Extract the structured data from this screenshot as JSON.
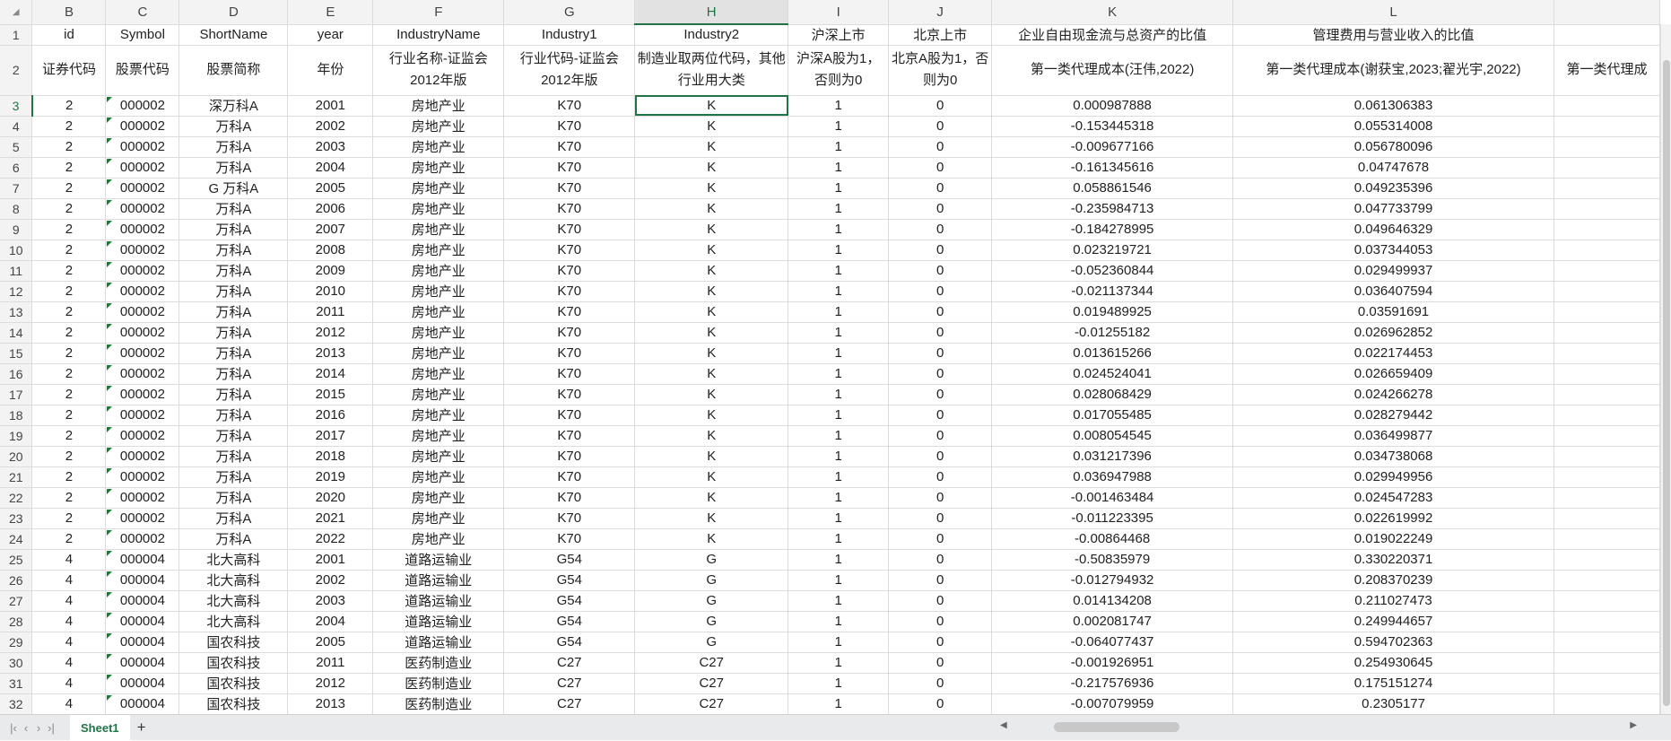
{
  "columns": [
    "B",
    "C",
    "D",
    "E",
    "F",
    "G",
    "H",
    "I",
    "J",
    "K",
    "L",
    ""
  ],
  "row1": [
    "id",
    "Symbol",
    "ShortName",
    "year",
    "IndustryName",
    "Industry1",
    "Industry2",
    "沪深上市",
    "北京上市",
    "企业自由现金流与总资产的比值",
    "管理费用与营业收入的比值",
    ""
  ],
  "row2": [
    "证券代码",
    "股票代码",
    "股票简称",
    "年份",
    "行业名称-证监会2012年版",
    "行业代码-证监会2012年版",
    "制造业取两位代码，其他行业用大类",
    "沪深A股为1，否则为0",
    "北京A股为1，否则为0",
    "第一类代理成本(汪伟,2022)",
    "第一类代理成本(谢获宝,2023;翟光宇,2022)",
    "第一类代理成"
  ],
  "rows": [
    [
      "2",
      "000002",
      "深万科A",
      "2001",
      "房地产业",
      "K70",
      "K",
      "1",
      "0",
      "0.000987888",
      "0.061306383"
    ],
    [
      "2",
      "000002",
      "万科A",
      "2002",
      "房地产业",
      "K70",
      "K",
      "1",
      "0",
      "-0.153445318",
      "0.055314008"
    ],
    [
      "2",
      "000002",
      "万科A",
      "2003",
      "房地产业",
      "K70",
      "K",
      "1",
      "0",
      "-0.009677166",
      "0.056780096"
    ],
    [
      "2",
      "000002",
      "万科A",
      "2004",
      "房地产业",
      "K70",
      "K",
      "1",
      "0",
      "-0.161345616",
      "0.04747678"
    ],
    [
      "2",
      "000002",
      "G 万科A",
      "2005",
      "房地产业",
      "K70",
      "K",
      "1",
      "0",
      "0.058861546",
      "0.049235396"
    ],
    [
      "2",
      "000002",
      "万科A",
      "2006",
      "房地产业",
      "K70",
      "K",
      "1",
      "0",
      "-0.235984713",
      "0.047733799"
    ],
    [
      "2",
      "000002",
      "万科A",
      "2007",
      "房地产业",
      "K70",
      "K",
      "1",
      "0",
      "-0.184278995",
      "0.049646329"
    ],
    [
      "2",
      "000002",
      "万科A",
      "2008",
      "房地产业",
      "K70",
      "K",
      "1",
      "0",
      "0.023219721",
      "0.037344053"
    ],
    [
      "2",
      "000002",
      "万科A",
      "2009",
      "房地产业",
      "K70",
      "K",
      "1",
      "0",
      "-0.052360844",
      "0.029499937"
    ],
    [
      "2",
      "000002",
      "万科A",
      "2010",
      "房地产业",
      "K70",
      "K",
      "1",
      "0",
      "-0.021137344",
      "0.036407594"
    ],
    [
      "2",
      "000002",
      "万科A",
      "2011",
      "房地产业",
      "K70",
      "K",
      "1",
      "0",
      "0.019489925",
      "0.03591691"
    ],
    [
      "2",
      "000002",
      "万科A",
      "2012",
      "房地产业",
      "K70",
      "K",
      "1",
      "0",
      "-0.01255182",
      "0.026962852"
    ],
    [
      "2",
      "000002",
      "万科A",
      "2013",
      "房地产业",
      "K70",
      "K",
      "1",
      "0",
      "0.013615266",
      "0.022174453"
    ],
    [
      "2",
      "000002",
      "万科A",
      "2014",
      "房地产业",
      "K70",
      "K",
      "1",
      "0",
      "0.024524041",
      "0.026659409"
    ],
    [
      "2",
      "000002",
      "万科A",
      "2015",
      "房地产业",
      "K70",
      "K",
      "1",
      "0",
      "0.028068429",
      "0.024266278"
    ],
    [
      "2",
      "000002",
      "万科A",
      "2016",
      "房地产业",
      "K70",
      "K",
      "1",
      "0",
      "0.017055485",
      "0.028279442"
    ],
    [
      "2",
      "000002",
      "万科A",
      "2017",
      "房地产业",
      "K70",
      "K",
      "1",
      "0",
      "0.008054545",
      "0.036499877"
    ],
    [
      "2",
      "000002",
      "万科A",
      "2018",
      "房地产业",
      "K70",
      "K",
      "1",
      "0",
      "0.031217396",
      "0.034738068"
    ],
    [
      "2",
      "000002",
      "万科A",
      "2019",
      "房地产业",
      "K70",
      "K",
      "1",
      "0",
      "0.036947988",
      "0.029949956"
    ],
    [
      "2",
      "000002",
      "万科A",
      "2020",
      "房地产业",
      "K70",
      "K",
      "1",
      "0",
      "-0.001463484",
      "0.024547283"
    ],
    [
      "2",
      "000002",
      "万科A",
      "2021",
      "房地产业",
      "K70",
      "K",
      "1",
      "0",
      "-0.011223395",
      "0.022619992"
    ],
    [
      "2",
      "000002",
      "万科A",
      "2022",
      "房地产业",
      "K70",
      "K",
      "1",
      "0",
      "-0.00864468",
      "0.019022249"
    ],
    [
      "4",
      "000004",
      "北大高科",
      "2001",
      "道路运输业",
      "G54",
      "G",
      "1",
      "0",
      "-0.50835979",
      "0.330220371"
    ],
    [
      "4",
      "000004",
      "北大高科",
      "2002",
      "道路运输业",
      "G54",
      "G",
      "1",
      "0",
      "-0.012794932",
      "0.208370239"
    ],
    [
      "4",
      "000004",
      "北大高科",
      "2003",
      "道路运输业",
      "G54",
      "G",
      "1",
      "0",
      "0.014134208",
      "0.211027473"
    ],
    [
      "4",
      "000004",
      "北大高科",
      "2004",
      "道路运输业",
      "G54",
      "G",
      "1",
      "0",
      "0.002081747",
      "0.249944657"
    ],
    [
      "4",
      "000004",
      "国农科技",
      "2005",
      "道路运输业",
      "G54",
      "G",
      "1",
      "0",
      "-0.064077437",
      "0.594702363"
    ],
    [
      "4",
      "000004",
      "国农科技",
      "2011",
      "医药制造业",
      "C27",
      "C27",
      "1",
      "0",
      "-0.001926951",
      "0.254930645"
    ],
    [
      "4",
      "000004",
      "国农科技",
      "2012",
      "医药制造业",
      "C27",
      "C27",
      "1",
      "0",
      "-0.217576936",
      "0.175151274"
    ],
    [
      "4",
      "000004",
      "国农科技",
      "2013",
      "医药制造业",
      "C27",
      "C27",
      "1",
      "0",
      "-0.007079959",
      "0.2305177"
    ]
  ],
  "sheet_tab": "Sheet1",
  "add_sheet": "+",
  "corner": "◢"
}
